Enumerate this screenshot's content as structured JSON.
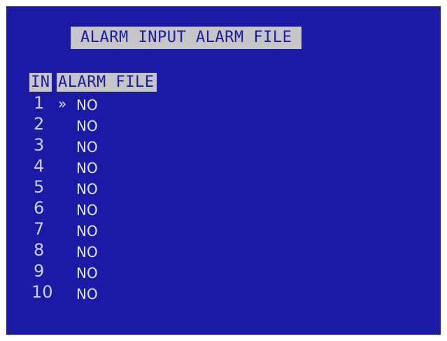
{
  "title": "ALARM INPUT ALARM FILE",
  "header": {
    "col_in": "IN",
    "col_alarm_file": "ALARM FILE"
  },
  "rows": [
    {
      "input": "1",
      "value": "NO",
      "marker": "»"
    },
    {
      "input": "2",
      "value": "NO",
      "marker": ""
    },
    {
      "input": "3",
      "value": "NO",
      "marker": ""
    },
    {
      "input": "4",
      "value": "NO",
      "marker": ""
    },
    {
      "input": "5",
      "value": "NO",
      "marker": ""
    },
    {
      "input": "6",
      "value": "NO",
      "marker": ""
    },
    {
      "input": "7",
      "value": "NO",
      "marker": ""
    },
    {
      "input": "8",
      "value": "NO",
      "marker": ""
    },
    {
      "input": "9",
      "value": "NO",
      "marker": ""
    },
    {
      "input": "10",
      "value": "NO",
      "marker": ""
    }
  ],
  "colors": {
    "background": "#1a1aa6",
    "highlight": "#c6c6c6",
    "text": "#e6e6e6"
  }
}
